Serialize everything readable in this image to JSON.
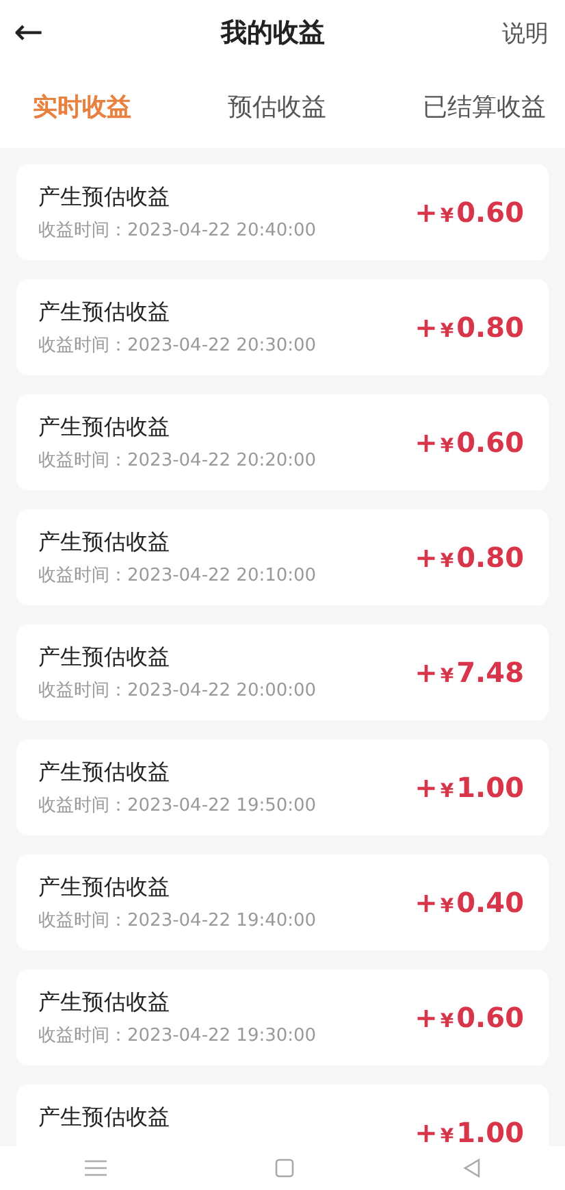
{
  "header": {
    "back": "←",
    "title": "我的收益",
    "action": "说明"
  },
  "tabs": [
    {
      "label": "实时收益",
      "selected": true
    },
    {
      "label": "预估收益",
      "selected": false
    },
    {
      "label": "已结算收益",
      "selected": false
    }
  ],
  "records": [
    {
      "title": "产生预估收益",
      "time": "收益时间：2023-04-22 20:40:00",
      "sign": "+",
      "currency": "¥",
      "amount": "0.60"
    },
    {
      "title": "产生预估收益",
      "time": "收益时间：2023-04-22 20:30:00",
      "sign": "+",
      "currency": "¥",
      "amount": "0.80"
    },
    {
      "title": "产生预估收益",
      "time": "收益时间：2023-04-22 20:20:00",
      "sign": "+",
      "currency": "¥",
      "amount": "0.60"
    },
    {
      "title": "产生预估收益",
      "time": "收益时间：2023-04-22 20:10:00",
      "sign": "+",
      "currency": "¥",
      "amount": "0.80"
    },
    {
      "title": "产生预估收益",
      "time": "收益时间：2023-04-22 20:00:00",
      "sign": "+",
      "currency": "¥",
      "amount": "7.48"
    },
    {
      "title": "产生预估收益",
      "time": "收益时间：2023-04-22 19:50:00",
      "sign": "+",
      "currency": "¥",
      "amount": "1.00"
    },
    {
      "title": "产生预估收益",
      "time": "收益时间：2023-04-22 19:40:00",
      "sign": "+",
      "currency": "¥",
      "amount": "0.40"
    },
    {
      "title": "产生预估收益",
      "time": "收益时间：2023-04-22 19:30:00",
      "sign": "+",
      "currency": "¥",
      "amount": "0.60"
    },
    {
      "title": "产生预估收益",
      "sign": "+",
      "currency": "¥",
      "amount": "1.00"
    }
  ]
}
